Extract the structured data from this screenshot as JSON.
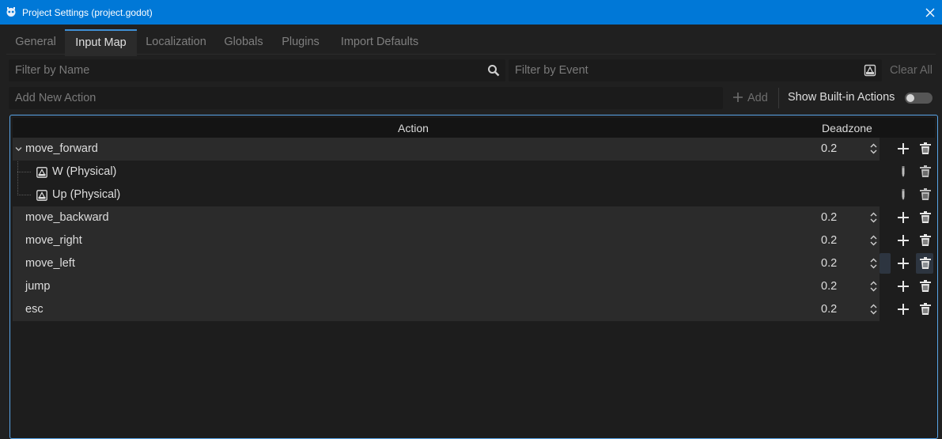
{
  "window": {
    "title": "Project Settings (project.godot)",
    "app_icon": "godot-icon",
    "close_icon": "close-icon"
  },
  "tabs": [
    {
      "label": "General",
      "active": false
    },
    {
      "label": "Input Map",
      "active": true
    },
    {
      "label": "Localization",
      "active": false
    },
    {
      "label": "Globals",
      "active": false
    },
    {
      "label": "Plugins",
      "active": false
    },
    {
      "label": "Import Defaults",
      "active": false
    }
  ],
  "filters": {
    "name_placeholder": "Filter by Name",
    "name_icon": "search-icon",
    "event_placeholder": "Filter by Event",
    "event_icon": "keyboard-icon",
    "clear_all": "Clear All"
  },
  "new_action": {
    "placeholder": "Add New Action",
    "add_label": "Add",
    "show_builtin_label": "Show Built-in Actions",
    "show_builtin_on": false
  },
  "table": {
    "col_action": "Action",
    "col_deadzone": "Deadzone",
    "actions": [
      {
        "name": "move_forward",
        "deadzone": "0.2",
        "expanded": true,
        "events": [
          {
            "label": "W (Physical)"
          },
          {
            "label": "Up (Physical)"
          }
        ]
      },
      {
        "name": "move_backward",
        "deadzone": "0.2"
      },
      {
        "name": "move_right",
        "deadzone": "0.2"
      },
      {
        "name": "move_left",
        "deadzone": "0.2"
      },
      {
        "name": "jump",
        "deadzone": "0.2"
      },
      {
        "name": "esc",
        "deadzone": "0.2"
      }
    ]
  },
  "colors": {
    "titlebar": "#0078d7",
    "accent": "#3f8fd4",
    "panel": "#202020",
    "row": "#2b2b2b"
  }
}
